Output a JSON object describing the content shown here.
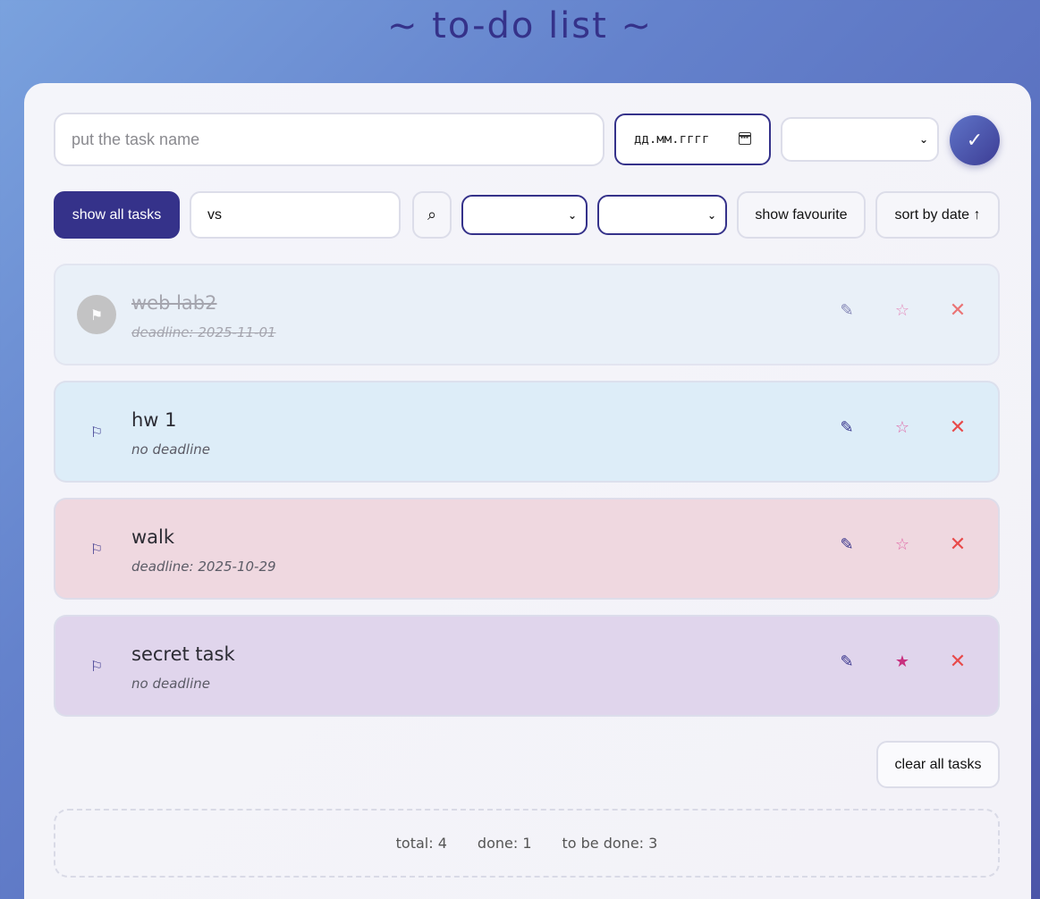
{
  "title": "~ to-do list ~",
  "add_form": {
    "task_placeholder": "put the task name",
    "date_placeholder": "дд.мм.гггг",
    "priority_value": "",
    "confirm_icon": "checkmark-icon",
    "confirm_glyph": "✓"
  },
  "toolbar": {
    "show_all_label": "show all tasks",
    "search_value": "vs",
    "search_glyph": "⌕",
    "filter_1_value": "",
    "filter_2_value": "",
    "show_favourite_label": "show favourite",
    "sort_label": "sort by date ↑"
  },
  "tasks": [
    {
      "name": "web lab2",
      "deadline": "deadline: 2025-11-01",
      "done": true,
      "favourite": false,
      "bg": "#e6eff8",
      "flag_glyph": "⚑",
      "edit_glyph": "✎",
      "fav_glyph": "☆",
      "del_glyph": "✕"
    },
    {
      "name": "hw 1",
      "deadline": "no deadline",
      "done": false,
      "favourite": false,
      "bg": "#ddedf8",
      "flag_glyph": "⚐",
      "edit_glyph": "✎",
      "fav_glyph": "☆",
      "del_glyph": "✕"
    },
    {
      "name": "walk",
      "deadline": "deadline: 2025-10-29",
      "done": false,
      "favourite": false,
      "bg": "#efd8e0",
      "flag_glyph": "⚐",
      "edit_glyph": "✎",
      "fav_glyph": "☆",
      "del_glyph": "✕"
    },
    {
      "name": "secret task",
      "deadline": "no deadline",
      "done": false,
      "favourite": true,
      "bg": "#e0d5ec",
      "flag_glyph": "⚐",
      "edit_glyph": "✎",
      "fav_glyph": "★",
      "del_glyph": "✕"
    }
  ],
  "clear_all_label": "clear all tasks",
  "stats": {
    "total": "total: 4",
    "done": "done: 1",
    "to_be_done": "to be done: 3"
  },
  "colors": {
    "accent": "#35328a",
    "favourite_star": "#c8307f",
    "delete": "#e84a4a"
  }
}
